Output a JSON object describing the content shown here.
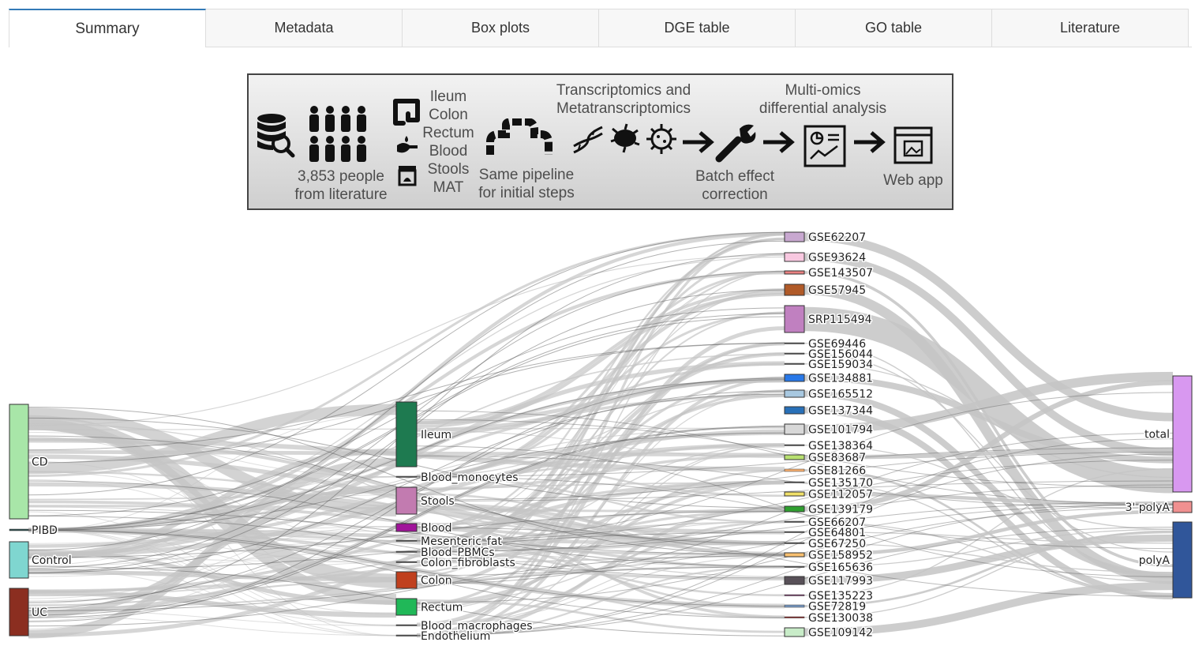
{
  "tabs": [
    {
      "label": "Summary",
      "active": true
    },
    {
      "label": "Metadata",
      "active": false
    },
    {
      "label": "Box plots",
      "active": false
    },
    {
      "label": "DGE table",
      "active": false
    },
    {
      "label": "GO table",
      "active": false
    },
    {
      "label": "Literature",
      "active": false
    }
  ],
  "banner": {
    "people": "3,853 people",
    "from_literature": "from literature",
    "tissues": [
      "Ileum",
      "Colon",
      "Rectum",
      "Blood",
      "Stools",
      "MAT"
    ],
    "same_pipeline": "Same pipeline",
    "initial_steps": "for initial steps",
    "transcriptomics": "Transcriptomics and",
    "metatranscriptomics": "Metatranscriptomics",
    "batch_effect": "Batch effect",
    "correction": "correction",
    "multiomics": "Multi-omics",
    "differential": "differential analysis",
    "web_app": "Web app",
    "icons": [
      "database-search-icon",
      "people-group-icon",
      "intestine-icon",
      "hand-blood-drop-icon",
      "stool-jar-icon",
      "pipeline-icon",
      "dna-icon",
      "bacteria-icon",
      "virus-icon",
      "arrow-right-icon",
      "wrench-icon",
      "report-chart-icon",
      "web-app-icon"
    ]
  },
  "sankey": {
    "diagnosis": [
      {
        "name": "CD",
        "color": "#a8e6a8"
      },
      {
        "name": "PIBD",
        "color": "#2f4f4f"
      },
      {
        "name": "Control",
        "color": "#7fd6d0"
      },
      {
        "name": "UC",
        "color": "#8b2e20"
      }
    ],
    "tissue": [
      {
        "name": "Ileum",
        "color": "#1e7a50"
      },
      {
        "name": "Blood_monocytes",
        "color": "#555555"
      },
      {
        "name": "Stools",
        "color": "#c27bb0"
      },
      {
        "name": "Blood",
        "color": "#a0149a"
      },
      {
        "name": "Mesenteric_fat",
        "color": "#555555"
      },
      {
        "name": "Blood_PBMCs",
        "color": "#555555"
      },
      {
        "name": "Colon_fibroblasts",
        "color": "#555555"
      },
      {
        "name": "Colon",
        "color": "#c0401e"
      },
      {
        "name": "Rectum",
        "color": "#20b858"
      },
      {
        "name": "Blood_macrophages",
        "color": "#555555"
      },
      {
        "name": "Endothelium",
        "color": "#555555"
      }
    ],
    "studies": [
      {
        "name": "GSE62207",
        "color": "#c8a8d0"
      },
      {
        "name": "GSE93624",
        "color": "#f8c8e0"
      },
      {
        "name": "GSE143507",
        "color": "#e88080"
      },
      {
        "name": "GSE57945",
        "color": "#b05a28"
      },
      {
        "name": "SRP115494",
        "color": "#c080c0"
      },
      {
        "name": "GSE69446",
        "color": "#555555"
      },
      {
        "name": "GSE156044",
        "color": "#555555"
      },
      {
        "name": "GSE159034",
        "color": "#555555"
      },
      {
        "name": "GSE134881",
        "color": "#2878e8"
      },
      {
        "name": "GSE165512",
        "color": "#a8c8e0"
      },
      {
        "name": "GSE137344",
        "color": "#2870b8"
      },
      {
        "name": "GSE101794",
        "color": "#d8d8d8"
      },
      {
        "name": "GSE138364",
        "color": "#555555"
      },
      {
        "name": "GSE83687",
        "color": "#b8e070"
      },
      {
        "name": "GSE81266",
        "color": "#f8b070"
      },
      {
        "name": "GSE135170",
        "color": "#555555"
      },
      {
        "name": "GSE112057",
        "color": "#f0e068"
      },
      {
        "name": "GSE139179",
        "color": "#30a030"
      },
      {
        "name": "GSE66207",
        "color": "#555555"
      },
      {
        "name": "GSE64801",
        "color": "#555555"
      },
      {
        "name": "GSE67250",
        "color": "#555555"
      },
      {
        "name": "GSE158952",
        "color": "#f8c070"
      },
      {
        "name": "GSE165636",
        "color": "#555555"
      },
      {
        "name": "GSE117993",
        "color": "#585058"
      },
      {
        "name": "GSE135223",
        "color": "#7a3a6a"
      },
      {
        "name": "GSE72819",
        "color": "#7898c0"
      },
      {
        "name": "GSE130038",
        "color": "#8b2020"
      },
      {
        "name": "GSE109142",
        "color": "#c8ecc8"
      }
    ],
    "library": [
      {
        "name": "total",
        "color": "#d898f0"
      },
      {
        "name": "3' polyA",
        "color": "#f09090"
      },
      {
        "name": "polyA",
        "color": "#30569a"
      }
    ],
    "link_color": "#c4c4c4"
  }
}
